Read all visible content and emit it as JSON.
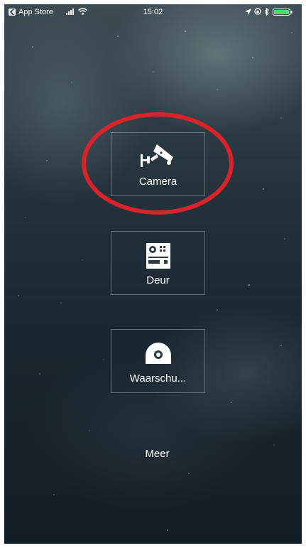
{
  "status_bar": {
    "back_app": "App Store",
    "time": "15:02",
    "icons": [
      "signal-icon",
      "wifi-icon",
      "location-icon",
      "lock-rotation-icon",
      "bluetooth-icon",
      "battery-icon"
    ]
  },
  "tiles": [
    {
      "label": "Camera",
      "icon": "security-camera-icon"
    },
    {
      "label": "Deur",
      "icon": "door-intercom-icon"
    },
    {
      "label": "Waarschu...",
      "icon": "alarm-sensor-icon"
    }
  ],
  "more_label": "Meer",
  "colors": {
    "highlight_circle": "#d9222a",
    "tile_border": "#c8d2d6",
    "text": "#ffffff"
  }
}
